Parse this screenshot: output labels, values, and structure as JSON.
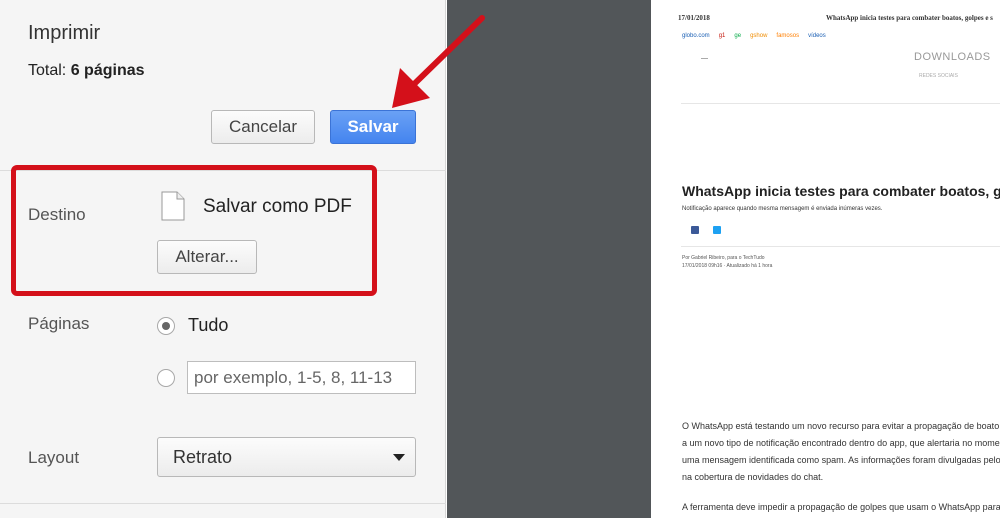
{
  "print_panel": {
    "title": "Imprimir",
    "total_label": "Total:",
    "total_value": "6 páginas",
    "cancel_label": "Cancelar",
    "save_label": "Salvar",
    "destination": {
      "label": "Destino",
      "value": "Salvar como PDF",
      "change_label": "Alterar..."
    },
    "pages": {
      "label": "Páginas",
      "option_all": "Tudo",
      "range_placeholder": "por exemplo, 1-5, 8, 11-13",
      "selected": "all"
    },
    "layout": {
      "label": "Layout",
      "value": "Retrato"
    }
  },
  "preview_page": {
    "date": "17/01/2018",
    "header_title": "WhatsApp inicia testes para combater boatos, golpes e s",
    "nav_links": [
      {
        "text": "globo.com",
        "color": "#1a5fb4"
      },
      {
        "text": "g1",
        "color": "#c4170c"
      },
      {
        "text": "ge",
        "color": "#06aa48"
      },
      {
        "text": "gshow",
        "color": "#f08c00"
      },
      {
        "text": "famosos",
        "color": "#ff7f00"
      },
      {
        "text": "vídeos",
        "color": "#1a5fb4"
      }
    ],
    "downloads_label": "DOWNLOADS",
    "downloads_sub": "REDES SOCIAIS",
    "headline": "WhatsApp inicia testes para combater boatos, golpes e",
    "subheadline": "Notificação aparece quando mesma mensagem é enviada inúmeras vezes.",
    "byline_1": "Por Gabriel Ribeiro, para o TechTudo",
    "byline_2": "17/01/2018 09h16 · Atualizado há 1 hora",
    "body_lines": [
      "O WhatsApp está testando um novo recurso para evitar a propagação de boato",
      "a um novo tipo de notificação encontrado dentro do app, que alertaria no mome",
      "uma mensagem identificada como spam. As informações foram divulgadas pelo",
      "na cobertura de novidades do chat."
    ],
    "body_line_last": "A ferramenta deve impedir a propagação de golpes que usam o WhatsApp para"
  },
  "colors": {
    "highlight": "#d4101a",
    "save_button": "#4484ef",
    "preview_background": "#525659",
    "facebook": "#3b5998",
    "twitter": "#1da1f2"
  }
}
